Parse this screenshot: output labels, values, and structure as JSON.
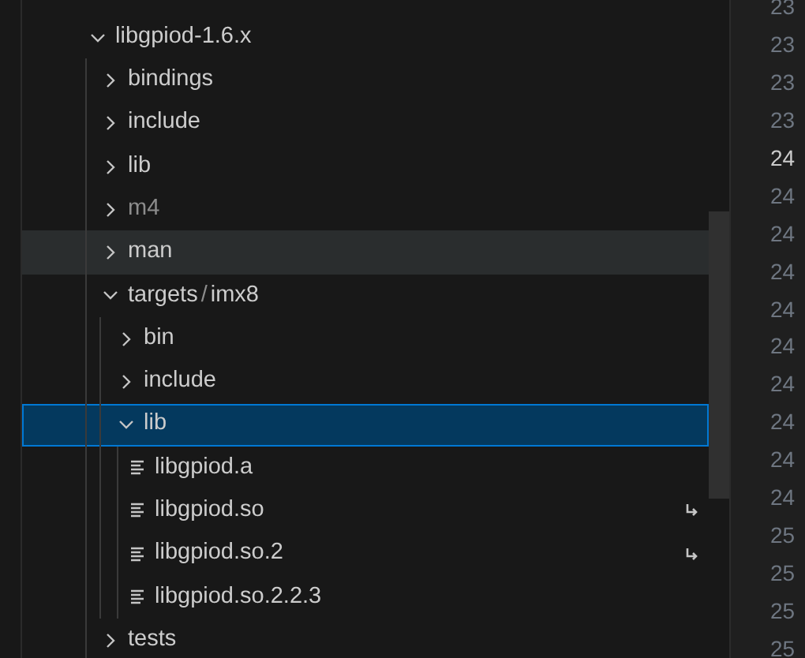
{
  "tree": [
    {
      "kind": "folder",
      "name": "libgpiod-1.6.x",
      "expanded": true,
      "selected": false,
      "hovered": false,
      "dimmed": false,
      "children": [
        {
          "kind": "folder",
          "name": "bindings",
          "expanded": false,
          "selected": false,
          "hovered": false,
          "dimmed": false
        },
        {
          "kind": "folder",
          "name": "include",
          "expanded": false,
          "selected": false,
          "hovered": false,
          "dimmed": false
        },
        {
          "kind": "folder",
          "name": "lib",
          "expanded": false,
          "selected": false,
          "hovered": false,
          "dimmed": false
        },
        {
          "kind": "folder",
          "name": "m4",
          "expanded": false,
          "selected": false,
          "hovered": false,
          "dimmed": true
        },
        {
          "kind": "folder",
          "name": "man",
          "expanded": false,
          "selected": false,
          "hovered": true,
          "dimmed": false
        },
        {
          "kind": "folder",
          "name": "targets",
          "separator": "/",
          "compact": "imx8",
          "expanded": true,
          "selected": false,
          "hovered": false,
          "dimmed": false,
          "children": [
            {
              "kind": "folder",
              "name": "bin",
              "expanded": false,
              "selected": false,
              "hovered": false,
              "dimmed": false
            },
            {
              "kind": "folder",
              "name": "include",
              "expanded": false,
              "selected": false,
              "hovered": false,
              "dimmed": false
            },
            {
              "kind": "folder",
              "name": "lib",
              "expanded": true,
              "selected": true,
              "hovered": false,
              "dimmed": false,
              "children": [
                {
                  "kind": "file",
                  "name": "libgpiod.a",
                  "symlink": false,
                  "selected": false,
                  "hovered": false,
                  "dimmed": false
                },
                {
                  "kind": "file",
                  "name": "libgpiod.so",
                  "symlink": true,
                  "selected": false,
                  "hovered": false,
                  "dimmed": false
                },
                {
                  "kind": "file",
                  "name": "libgpiod.so.2",
                  "symlink": true,
                  "selected": false,
                  "hovered": false,
                  "dimmed": false
                },
                {
                  "kind": "file",
                  "name": "libgpiod.so.2.2.3",
                  "symlink": false,
                  "selected": false,
                  "hovered": false,
                  "dimmed": false
                }
              ]
            }
          ]
        },
        {
          "kind": "folder",
          "name": "tests",
          "expanded": false,
          "selected": false,
          "hovered": false,
          "dimmed": false
        }
      ]
    }
  ],
  "line_numbers": [
    {
      "text": "23",
      "current": false
    },
    {
      "text": "23",
      "current": false
    },
    {
      "text": "23",
      "current": false
    },
    {
      "text": "23",
      "current": false
    },
    {
      "text": "24",
      "current": true
    },
    {
      "text": "24",
      "current": false
    },
    {
      "text": "24",
      "current": false
    },
    {
      "text": "24",
      "current": false
    },
    {
      "text": "24",
      "current": false
    },
    {
      "text": "24",
      "current": false
    },
    {
      "text": "24",
      "current": false
    },
    {
      "text": "24",
      "current": false
    },
    {
      "text": "24",
      "current": false
    },
    {
      "text": "24",
      "current": false
    },
    {
      "text": "25",
      "current": false
    },
    {
      "text": "25",
      "current": false
    },
    {
      "text": "25",
      "current": false
    },
    {
      "text": "25",
      "current": false
    }
  ]
}
